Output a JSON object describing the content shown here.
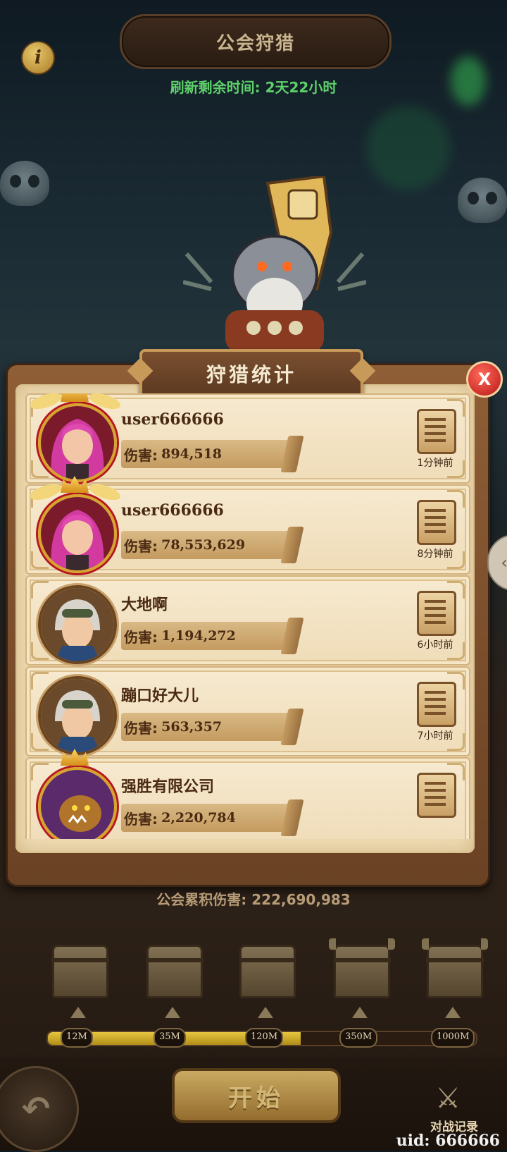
{
  "header": {
    "title": "公会狩猎",
    "info_icon_text": "i",
    "refresh_text": "刷新剩余时间: 2天22小时"
  },
  "panel": {
    "title": "狩猎统计",
    "close_label": "X",
    "damage_label": "伤害:",
    "rows": [
      {
        "name": "user666666",
        "damage": "894,518",
        "time": "1分钟前",
        "avatar": "pink-hair-heroine",
        "frame": "gold"
      },
      {
        "name": "user666666",
        "damage": "78,553,629",
        "time": "8分钟前",
        "avatar": "pink-hair-heroine",
        "frame": "gold"
      },
      {
        "name": "大地啊",
        "damage": "1,194,272",
        "time": "6小时前",
        "avatar": "goggles-engineer",
        "frame": "brown"
      },
      {
        "name": "蹦口好大儿",
        "damage": "563,357",
        "time": "7小时前",
        "avatar": "goggles-engineer",
        "frame": "brown"
      },
      {
        "name": "强胜有限公司",
        "damage": "2,220,784",
        "time": "",
        "avatar": "orc-monster",
        "frame": "gold"
      }
    ]
  },
  "guild_total": "公会累积伤害: 222,690,983",
  "rewards": {
    "milestones": [
      "12M",
      "35M",
      "120M",
      "350M",
      "1000M"
    ],
    "progress_fraction": 0.59
  },
  "buttons": {
    "start": "开始",
    "battle_log": "对战记录",
    "back_icon": "↶",
    "battle_icon": "⚔"
  },
  "uid": "uid: 666666",
  "colors": {
    "accent_green": "#5ed06a",
    "close_red": "#b81616",
    "gold": "#d8a32e"
  }
}
